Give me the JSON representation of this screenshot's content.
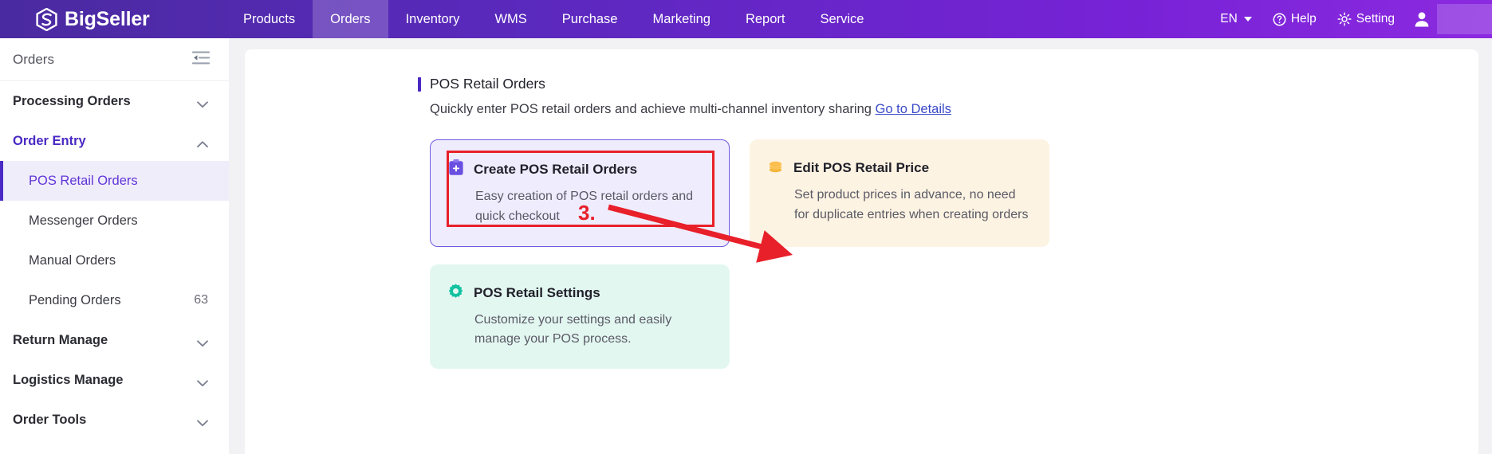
{
  "brand": {
    "name": "BigSeller",
    "logo_icon": "bigseller-logo-icon"
  },
  "topnav": {
    "items": [
      {
        "label": "Products",
        "active": false
      },
      {
        "label": "Orders",
        "active": true
      },
      {
        "label": "Inventory",
        "active": false
      },
      {
        "label": "WMS",
        "active": false
      },
      {
        "label": "Purchase",
        "active": false
      },
      {
        "label": "Marketing",
        "active": false
      },
      {
        "label": "Report",
        "active": false
      },
      {
        "label": "Service",
        "active": false
      }
    ],
    "language": "EN",
    "help": "Help",
    "setting": "Setting",
    "help_icon": "question-circle-icon",
    "setting_icon": "gear-icon",
    "avatar_icon": "user-avatar-icon",
    "chevron_icon": "chevron-down-icon"
  },
  "sidebar": {
    "title": "Orders",
    "collapse_icon": "collapse-sidebar-icon",
    "items": [
      {
        "label": "Processing Orders",
        "type": "group",
        "state": "collapsed",
        "badge": ""
      },
      {
        "label": "Order Entry",
        "type": "group",
        "state": "expanded",
        "badge": ""
      },
      {
        "label": "POS Retail Orders",
        "type": "sub",
        "selected": true,
        "badge": ""
      },
      {
        "label": "Messenger Orders",
        "type": "sub",
        "selected": false,
        "badge": ""
      },
      {
        "label": "Manual Orders",
        "type": "sub",
        "selected": false,
        "badge": ""
      },
      {
        "label": "Pending Orders",
        "type": "sub",
        "selected": false,
        "badge": "63"
      },
      {
        "label": "Return Manage",
        "type": "group",
        "state": "collapsed",
        "badge": ""
      },
      {
        "label": "Logistics Manage",
        "type": "group",
        "state": "collapsed",
        "badge": ""
      },
      {
        "label": "Order Tools",
        "type": "group",
        "state": "collapsed",
        "badge": ""
      }
    ]
  },
  "main": {
    "page_title": "POS Retail Orders",
    "subtitle_text": "Quickly enter POS retail orders and achieve multi-channel inventory sharing ",
    "subtitle_link": "Go to Details",
    "cards": [
      {
        "title": "Create POS Retail Orders",
        "desc": "Easy creation of POS retail orders and quick checkout",
        "icon": "clipboard-plus-icon",
        "theme": "violet",
        "highlighted": true
      },
      {
        "title": "Edit POS Retail Price",
        "desc": "Set product prices in advance, no need for duplicate entries when creating orders",
        "icon": "coins-stack-icon",
        "theme": "amber",
        "highlighted": false
      },
      {
        "title": "POS Retail Settings",
        "desc": "Customize your settings and easily manage your POS process.",
        "icon": "gear-icon",
        "theme": "mint",
        "highlighted": false
      }
    ]
  },
  "annotation": {
    "step_label": "3.",
    "arrow_icon": "red-arrow-icon",
    "highlight_color": "#e8202a"
  },
  "colors": {
    "brand_purple": "#5a29bd",
    "accent_violet": "#4a29c4",
    "link_blue": "#3b4bc8",
    "annotation_red": "#e8202a",
    "card_violet_bg": "#efecfd",
    "card_amber_bg": "#fdf3e2",
    "card_mint_bg": "#e3f7f1"
  }
}
